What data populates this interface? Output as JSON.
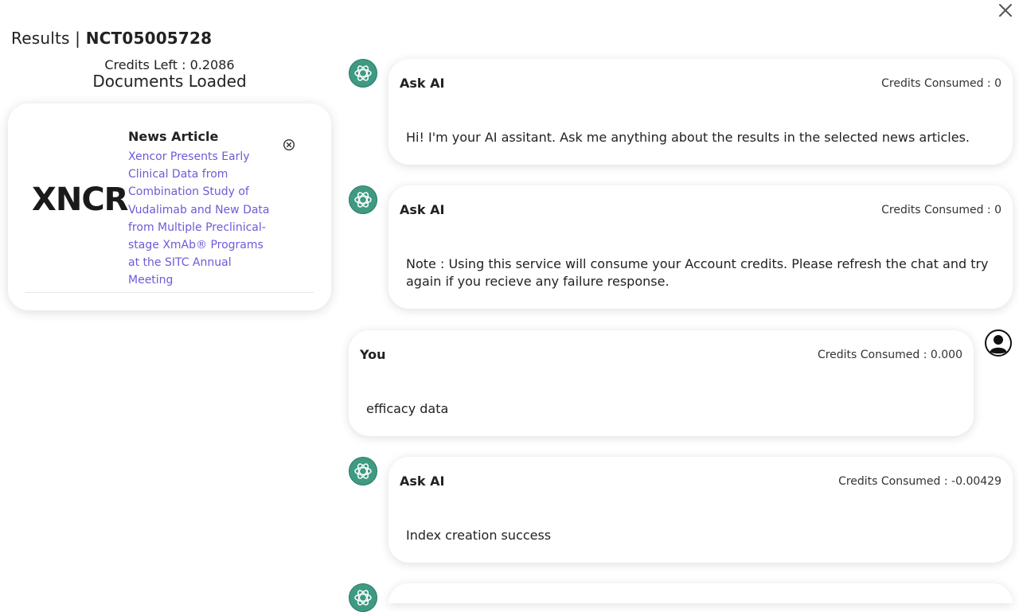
{
  "header": {
    "prefix": "Results |",
    "trial_id": "NCT05005728"
  },
  "sidebar": {
    "credits_left": "Credits Left : 0.2086",
    "documents_loaded": "Documents Loaded",
    "documents": [
      {
        "logo_text": "XNCR",
        "type": "News Article",
        "title": "Xencor Presents Early Clinical Data from Combination Study of Vudalimab and New Data from Multiple Preclinical-stage XmAb® Programs at the SITC Annual Meeting"
      }
    ]
  },
  "chat": {
    "messages": [
      {
        "sender": "Ask AI",
        "credits": "Credits Consumed : 0",
        "text": "Hi! I'm your AI assitant. Ask me anything about the results in the selected news articles."
      },
      {
        "sender": "Ask AI",
        "credits": "Credits Consumed : 0",
        "text": "Note : Using this service will consume your Account credits. Please refresh the chat and try again if you recieve any failure response."
      },
      {
        "sender": "You",
        "credits": "Credits Consumed : 0.000",
        "text": "efficacy data"
      },
      {
        "sender": "Ask AI",
        "credits": "Credits Consumed : -0.00429",
        "text": "Index creation success"
      }
    ]
  },
  "icons": {
    "close": "close-icon",
    "remove_document": "circle-x-icon",
    "ai_avatar": "openai-logo-icon",
    "user_avatar": "user-icon"
  },
  "colors": {
    "link": "#6c5cd6",
    "ai_avatar_bg": "#3f9a83"
  }
}
